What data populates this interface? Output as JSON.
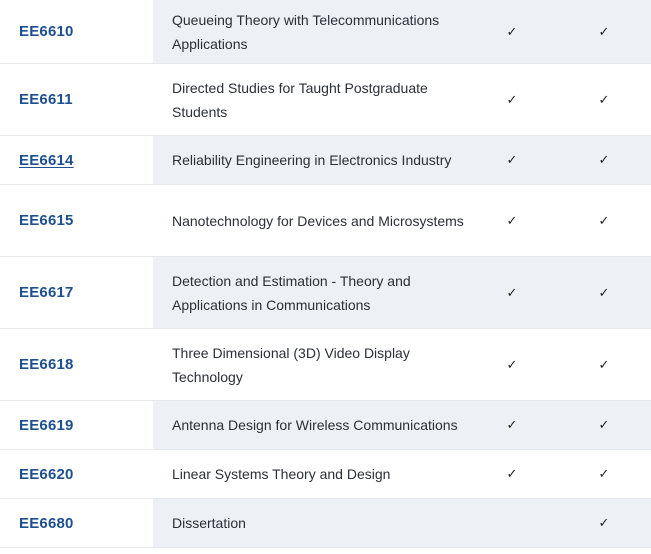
{
  "check_mark": "✓",
  "courses": [
    {
      "code": "EE6610",
      "title": "Queueing Theory with Telecommunications Applications",
      "col1": "✓",
      "col2": "✓"
    },
    {
      "code": "EE6611",
      "title": "Directed Studies for Taught Postgraduate Students",
      "col1": "✓",
      "col2": "✓"
    },
    {
      "code": "EE6614",
      "title": "Reliability Engineering in Electronics Industry",
      "col1": "✓",
      "col2": "✓"
    },
    {
      "code": "EE6615",
      "title": "Nanotechnology for Devices and Microsystems",
      "col1": "✓",
      "col2": "✓"
    },
    {
      "code": "EE6617",
      "title": "Detection and Estimation - Theory and Applications in Communications",
      "col1": "✓",
      "col2": "✓"
    },
    {
      "code": "EE6618",
      "title": "Three Dimensional (3D) Video Display Technology",
      "col1": "✓",
      "col2": "✓"
    },
    {
      "code": "EE6619",
      "title": "Antenna Design for Wireless Communications",
      "col1": "✓",
      "col2": "✓"
    },
    {
      "code": "EE6620",
      "title": "Linear Systems Theory and Design",
      "col1": "✓",
      "col2": "✓"
    },
    {
      "code": "EE6680",
      "title": "Dissertation",
      "col1": "",
      "col2": "✓"
    }
  ],
  "colors": {
    "link": "#1d4f91",
    "shaded_row": "#edf0f4",
    "text": "#2b2f36"
  }
}
